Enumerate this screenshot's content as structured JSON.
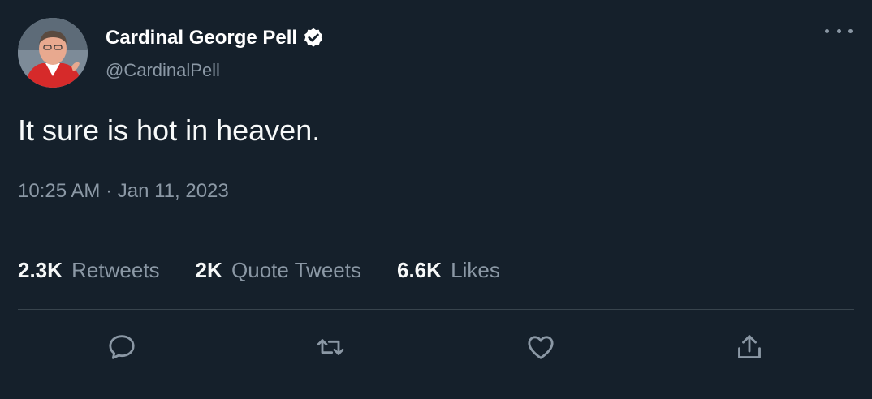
{
  "user": {
    "display_name": "Cardinal George Pell",
    "handle": "@CardinalPell",
    "verified": true
  },
  "tweet": {
    "text": "It sure is hot in heaven.",
    "timestamp": "10:25 AM · Jan 11, 2023"
  },
  "stats": [
    {
      "count": "2.3K",
      "label": "Retweets"
    },
    {
      "count": "2K",
      "label": "Quote Tweets"
    },
    {
      "count": "6.6K",
      "label": "Likes"
    }
  ],
  "actions": [
    "reply-icon",
    "retweet-icon",
    "like-icon",
    "share-icon"
  ],
  "colors": {
    "background": "#15202b",
    "text": "#f7f9f9",
    "secondary": "#8b98a5",
    "divider": "#38444d"
  }
}
